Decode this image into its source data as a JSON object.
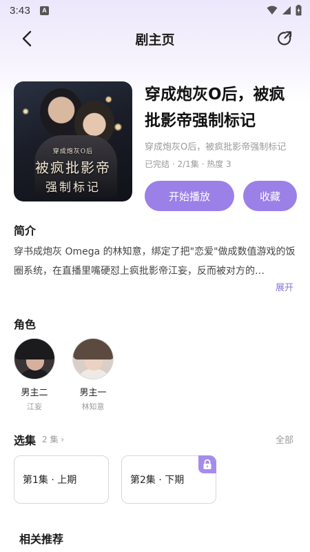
{
  "status": {
    "time": "3:43",
    "notification_letter": "A"
  },
  "header": {
    "title": "剧主页"
  },
  "drama": {
    "title": "穿成炮灰O后，被疯批影帝强制标记",
    "subtitle": "穿成炮灰O后，被疯批影帝强制标记",
    "meta": "已完结 · 2/1集 · 热度 3",
    "cover_text_small": "穿成炮灰O后",
    "cover_text_big": "被疯批影帝",
    "cover_text_mid": "强制标记"
  },
  "actions": {
    "play_label": "开始播放",
    "favorite_label": "收藏"
  },
  "intro": {
    "title": "简介",
    "text": "穿书成炮灰 Omega 的林知意，绑定了把\"恋爱\"做成数值游戏的饭圈系统，在直播里嘴硬怼上疯批影帝江妄，反而被对方的…",
    "expand_label": "展开"
  },
  "roles": {
    "title": "角色",
    "items": [
      {
        "role": "男主二",
        "actor": "江妄"
      },
      {
        "role": "男主一",
        "actor": "林知意"
      }
    ]
  },
  "episodes": {
    "title": "选集",
    "count_label": "2 集 ›",
    "all_label": "全部",
    "items": [
      {
        "label": "第1集 · 上期",
        "locked": false
      },
      {
        "label": "第2集 · 下期",
        "locked": true
      }
    ]
  },
  "related": {
    "title": "相关推荐"
  },
  "colors": {
    "accent": "#9b80e8",
    "expand": "#8a73db",
    "lock": "#a58cec"
  }
}
